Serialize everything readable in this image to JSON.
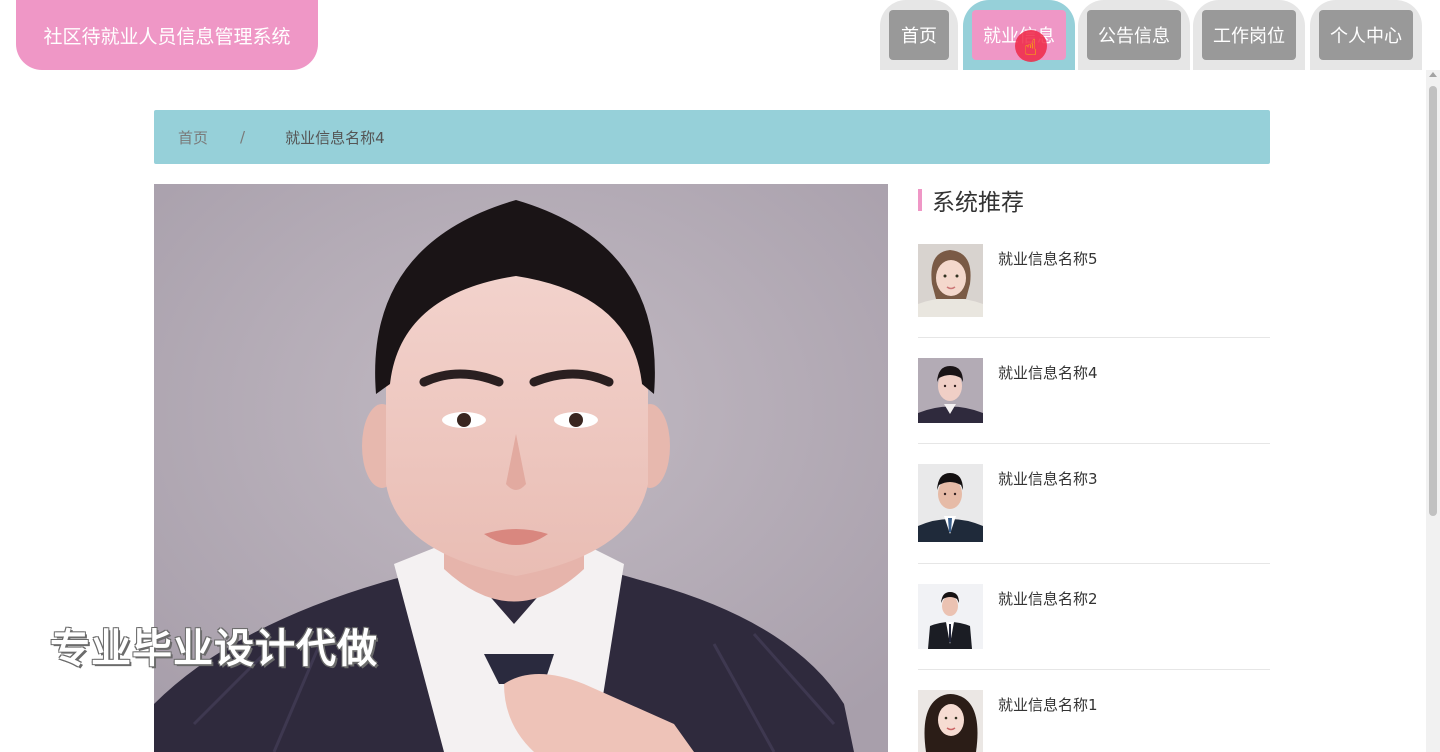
{
  "site": {
    "title": "社区待就业人员信息管理系统"
  },
  "nav": {
    "items": [
      {
        "label": "首页",
        "active": false
      },
      {
        "label": "就业信息",
        "active": true
      },
      {
        "label": "公告信息",
        "active": false
      },
      {
        "label": "工作岗位",
        "active": false
      },
      {
        "label": "个人中心",
        "active": false
      }
    ]
  },
  "breadcrumb": {
    "home": "首页",
    "separator": "/",
    "current": "就业信息名称4"
  },
  "main_photo": {
    "subject": "portrait-photo"
  },
  "watermark": "专业毕业设计代做",
  "sidebar": {
    "title": "系统推荐",
    "items": [
      {
        "name": "就业信息名称5"
      },
      {
        "name": "就业信息名称4"
      },
      {
        "name": "就业信息名称3"
      },
      {
        "name": "就业信息名称2"
      },
      {
        "name": "就业信息名称1"
      }
    ]
  },
  "colors": {
    "pink": "#ef97c6",
    "teal": "#96d0d9",
    "nav_gray": "#999999"
  }
}
